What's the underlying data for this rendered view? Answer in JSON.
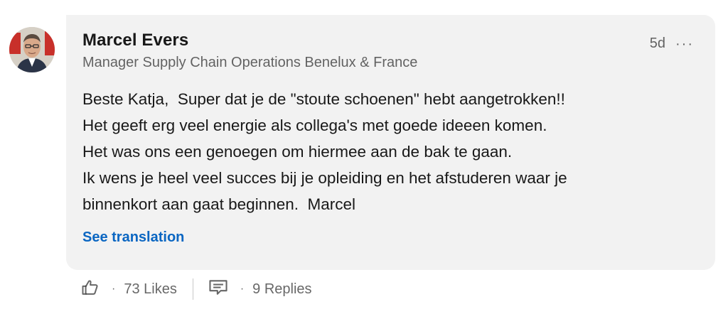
{
  "comment": {
    "author_name": "Marcel Evers",
    "author_headline": "Manager Supply Chain Operations Benelux & France",
    "time_ago": "5d",
    "more_label": "···",
    "lines": [
      "Beste Katja,  Super dat je de \"stoute schoenen\" hebt aangetrokken!!",
      "Het geeft erg veel energie als collega's met goede ideeen komen.",
      "Het was ons een genoegen om hiermee aan de bak te gaan.",
      "Ik wens je heel veel succes bij je opleiding en het afstuderen waar je",
      "binnenkort aan gaat beginnen.  Marcel"
    ],
    "see_translation": "See translation"
  },
  "actions": {
    "like_icon": "thumbs-up-icon",
    "likes_label": "73 Likes",
    "reply_icon": "comment-icon",
    "replies_label": "9 Replies",
    "separator": "·"
  },
  "colors": {
    "bubble_bg": "#f2f2f2",
    "link": "#0a66c2"
  }
}
